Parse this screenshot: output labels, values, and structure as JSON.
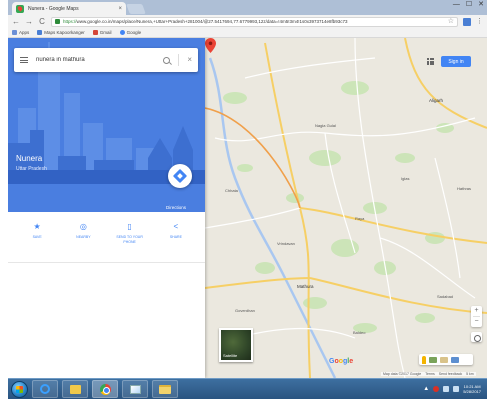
{
  "browser": {
    "tab_title": "Nunera - Google Maps",
    "tab_close": "×",
    "window_controls": [
      "—",
      "☐",
      "✕"
    ],
    "back": "←",
    "forward": "→",
    "reload": "C",
    "url_scheme": "https://",
    "url_rest": "www.google.co.in/maps/place/Nunera,+Uttar+Pradesh+281004/@27.5417694,77.6779993,12z/data=!4m5!3m4!1s0x3973714e8fb93c73",
    "star": "☆",
    "menu": "⋮",
    "bookmarks": [
      {
        "label": "Apps",
        "icon": "apps"
      },
      {
        "label": "Maps Kapoorkanger",
        "icon": "maps"
      },
      {
        "label": "Gmail",
        "icon": "gmail"
      },
      {
        "label": "Google",
        "icon": "google"
      }
    ]
  },
  "panel": {
    "search_value": "nunera in mathura",
    "place_title": "Nunera",
    "place_subtitle": "Uttar Pradesh",
    "directions_label": "Directions",
    "actions": [
      {
        "label": "SAVE",
        "icon": "bookmark-icon",
        "glyph": "★"
      },
      {
        "label": "NEARBY",
        "icon": "nearby-icon",
        "glyph": "◎"
      },
      {
        "label": "SEND TO YOUR PHONE",
        "icon": "phone-icon",
        "glyph": "▯"
      },
      {
        "label": "SHARE",
        "icon": "share-icon",
        "glyph": "<"
      }
    ]
  },
  "map": {
    "signin_label": "Sign in",
    "layers_label": "Satellite",
    "zoom_in": "+",
    "zoom_out": "−",
    "google_letters": [
      "G",
      "o",
      "o",
      "g",
      "l",
      "e"
    ],
    "attribution": [
      "Map data ©2017 Google",
      "Terms",
      "Send feedback",
      "5 km"
    ],
    "labels": [
      {
        "text": "Aligarh"
      },
      {
        "text": "Iglas"
      },
      {
        "text": "Raya"
      },
      {
        "text": "Mathura"
      },
      {
        "text": "Vrindavan"
      },
      {
        "text": "Sadabad"
      },
      {
        "text": "Hathras"
      },
      {
        "text": "Baldeo"
      },
      {
        "text": "Nagla Gulal"
      },
      {
        "text": "Goverdhan"
      },
      {
        "text": "Chhata"
      }
    ],
    "pin_color": "#ea4335"
  },
  "taskbar": {
    "time": "10:21 AM",
    "date": "5/28/2017",
    "tray_chevron": "▲"
  }
}
